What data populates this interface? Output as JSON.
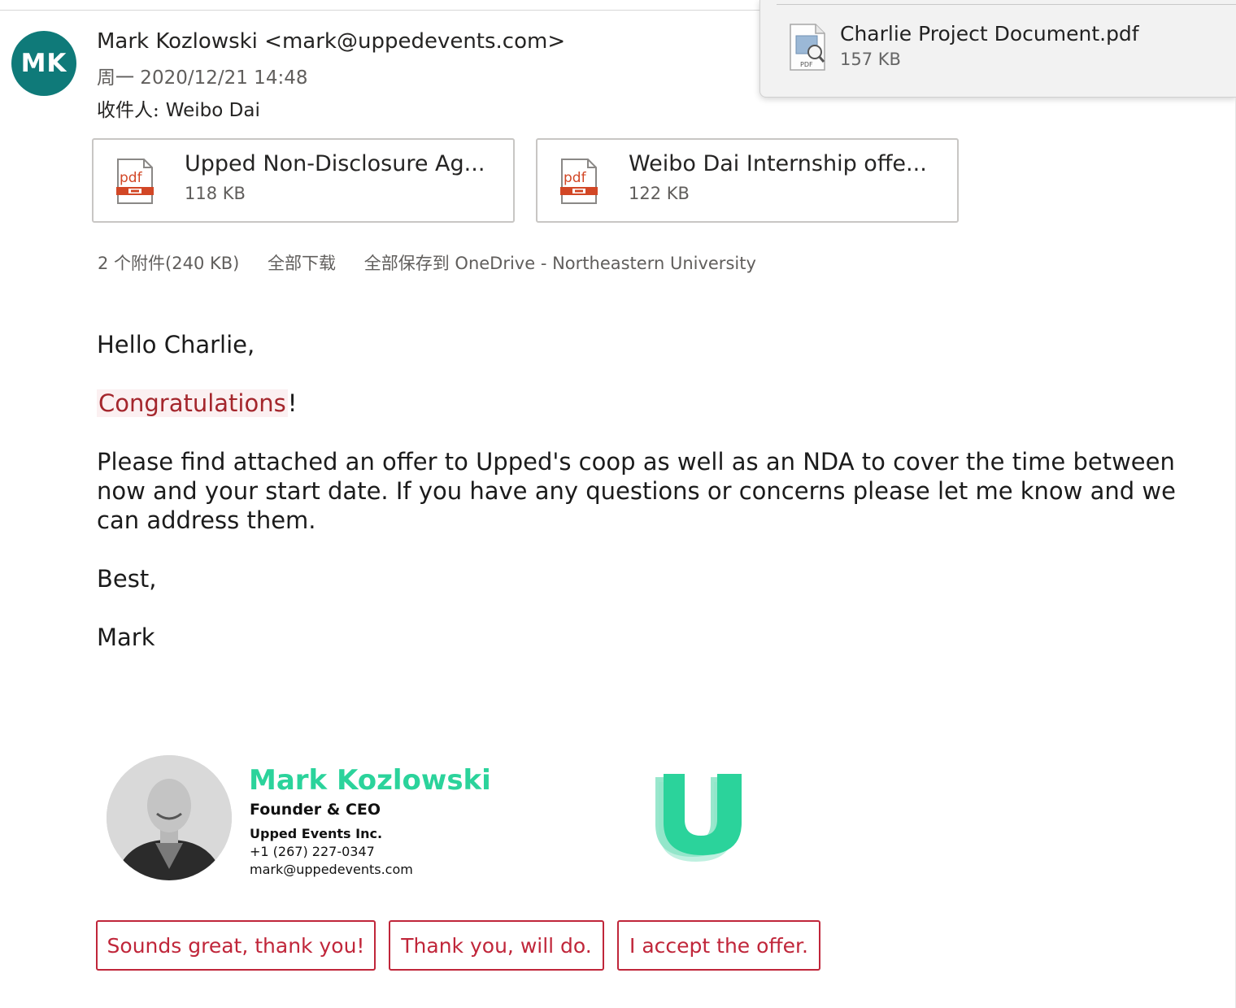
{
  "message": {
    "avatar_initials": "MK",
    "sender": "Mark Kozlowski <mark@uppedevents.com>",
    "date": "周一 2020/12/21 14:48",
    "to_label": "收件人:",
    "to_value": "Weibo Dai"
  },
  "attachments": [
    {
      "name": "Upped Non-Disclosure Ag...",
      "size": "118 KB",
      "icon": "pdf-file-icon"
    },
    {
      "name": "Weibo Dai Internship offe...",
      "size": "122 KB",
      "icon": "pdf-file-icon"
    }
  ],
  "attachment_actions": {
    "summary": "2 个附件(240 KB)",
    "download_all": "全部下载",
    "save_all": "全部保存到 OneDrive - Northeastern University"
  },
  "body": {
    "greeting": "Hello Charlie,",
    "congrats_word": "Congratulations",
    "congrats_punct": "!",
    "paragraph": "Please find attached an offer to Upped's coop as well as an NDA to cover the time between now and your start date.  If you have any questions or concerns please let me know and we can address them.",
    "closing": "Best,",
    "signoff": "Mark"
  },
  "signature": {
    "name": "Mark Kozlowski",
    "title": "Founder & CEO",
    "company": "Upped Events Inc.",
    "phone": "+1 (267) 227-0347",
    "email": "mark@uppedevents.com",
    "brand_color": "#2bd39b"
  },
  "quick_replies": [
    "Sounds great, thank you!",
    "Thank you, will do.",
    "I accept the offer."
  ],
  "download_panel": {
    "file_name": "Charlie Project Document.pdf",
    "file_size": "157 KB",
    "icon_label": "PDF"
  },
  "colors": {
    "avatar": "#0f7a79",
    "accent_red": "#c0263a",
    "pdf_red": "#d24726"
  }
}
